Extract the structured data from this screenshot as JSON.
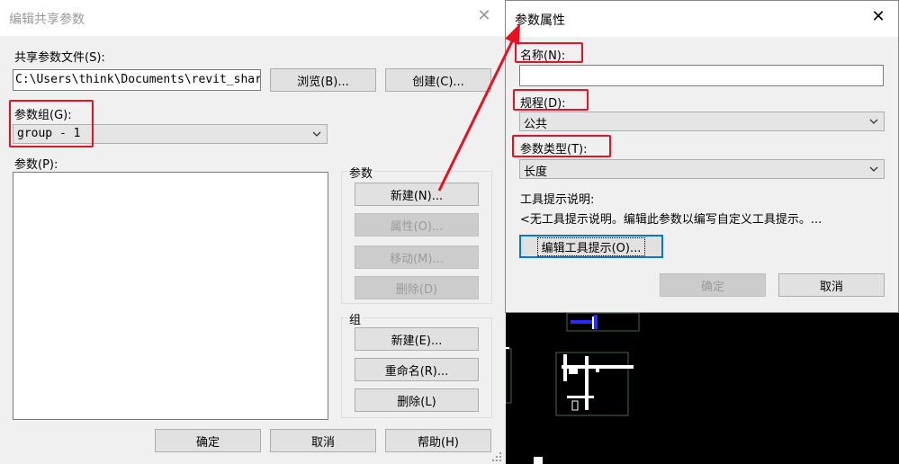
{
  "left_dialog": {
    "title": "编辑共享参数",
    "shared_file_label": "共享参数文件(S):",
    "shared_file_path": "C:\\Users\\think\\Documents\\revit_shared_parameters.txt",
    "browse_label": "浏览(B)...",
    "create_label": "创建(C)...",
    "group_label": "参数组(G):",
    "group_value": "group - 1",
    "params_label": "参数(P):",
    "params_groupbox_title": "参数",
    "btn_new_param": "新建(N)...",
    "btn_properties": "属性(O)...",
    "btn_move": "移动(M)...",
    "btn_delete_param": "删除(D)",
    "groups_groupbox_title": "组",
    "btn_new_group": "新建(E)...",
    "btn_rename_group": "重命名(R)...",
    "btn_delete_group": "删除(L)",
    "ok_label": "确定",
    "cancel_label": "取消",
    "help_label": "帮助(H)"
  },
  "right_dialog": {
    "title": "参数属性",
    "name_label": "名称(N):",
    "name_value": "",
    "discipline_label": "规程(D):",
    "discipline_value": "公共",
    "type_label": "参数类型(T):",
    "type_value": "长度",
    "tooltip_label": "工具提示说明:",
    "tooltip_text": "<无工具提示说明。编辑此参数以编写自定义工具提示。...",
    "edit_tooltip_label": "编辑工具提示(O)...",
    "ok_label": "确定",
    "cancel_label": "取消"
  },
  "colors": {
    "highlight": "#e81123",
    "focus": "#0078d7",
    "dialog_bg": "#f0f0f0"
  }
}
